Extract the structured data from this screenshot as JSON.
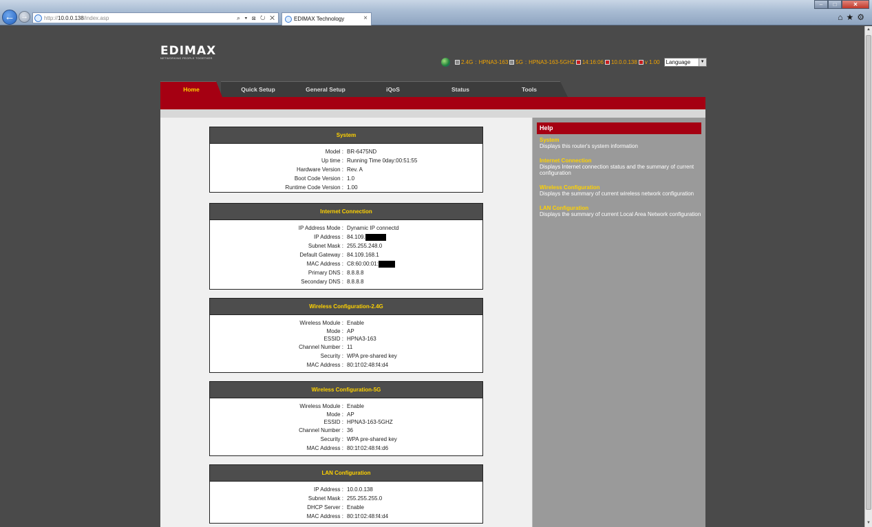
{
  "browser": {
    "url_prefix": "http://",
    "url_host": "10.0.0.138",
    "url_path": "/index.asp",
    "tab_title": "EDIMAX Technology",
    "tab_close": "×",
    "address_tools": "⌕ ▾ ⊠ ↻ ✕",
    "window_min": "–",
    "window_max": "□",
    "window_close": "✕",
    "icons": {
      "home": "home-icon",
      "star": "star-icon",
      "gear": "gear-icon"
    }
  },
  "header": {
    "logo": "EDIMAX",
    "tagline": "NETWORKING PEOPLE TOGETHER",
    "status": {
      "band1": "2.4G",
      "ssid1": "HPNA3-163",
      "band2": "5G",
      "ssid2": "HPNA3-163-5GHZ",
      "time": "14:16:06",
      "ip": "10.0.0.138",
      "version": "v 1.00"
    },
    "language": "Language"
  },
  "nav": {
    "tabs": [
      "Home",
      "Quick Setup",
      "General Setup",
      "iQoS",
      "Status",
      "Tools"
    ],
    "active": "Home"
  },
  "panels": {
    "system": {
      "title": "System",
      "rows": [
        {
          "k": "Model :",
          "v": "BR-6475ND"
        },
        {
          "k": "Up time :",
          "v": "Running Time 0day:00:51:55"
        },
        {
          "k": "Hardware Version :",
          "v": "Rev. A"
        },
        {
          "k": "Boot Code Version :",
          "v": "1.0"
        },
        {
          "k": "Runtime Code Version :",
          "v": "1.00"
        }
      ]
    },
    "internet": {
      "title": "Internet Connection",
      "rows": [
        {
          "k": "IP Address Mode :",
          "v": "Dynamic IP connectd"
        },
        {
          "k": "IP Address :",
          "v": "84.109."
        },
        {
          "k": "Subnet Mask :",
          "v": "255.255.248.0"
        },
        {
          "k": "Default Gateway :",
          "v": "84.109.168.1"
        },
        {
          "k": "MAC Address :",
          "v": "C8:60:00:01:"
        },
        {
          "k": "Primary DNS :",
          "v": "8.8.8.8"
        },
        {
          "k": "Secondary DNS :",
          "v": "8.8.8.8"
        }
      ]
    },
    "wireless24": {
      "title": "Wireless Configuration-2.4G",
      "rows": [
        {
          "k": "Wireless Module :",
          "v": "Enable"
        },
        {
          "k": "Mode :",
          "v": "AP"
        },
        {
          "k": "ESSID :",
          "v": "HPNA3-163"
        },
        {
          "k": "Channel Number :",
          "v": "11"
        },
        {
          "k": "Security :",
          "v": "WPA pre-shared key"
        },
        {
          "k": "MAC Address :",
          "v": "80:1f:02:48:f4:d4"
        }
      ]
    },
    "wireless5": {
      "title": "Wireless Configuration-5G",
      "rows": [
        {
          "k": "Wireless Module :",
          "v": "Enable"
        },
        {
          "k": "Mode :",
          "v": "AP"
        },
        {
          "k": "ESSID :",
          "v": "HPNA3-163-5GHZ"
        },
        {
          "k": "Channel Number :",
          "v": "36"
        },
        {
          "k": "Security :",
          "v": "WPA pre-shared key"
        },
        {
          "k": "MAC Address :",
          "v": "80:1f:02:48:f4:d6"
        }
      ]
    },
    "lan": {
      "title": "LAN Configuration",
      "rows": [
        {
          "k": "IP Address :",
          "v": "10.0.0.138"
        },
        {
          "k": "Subnet Mask :",
          "v": "255.255.255.0"
        },
        {
          "k": "DHCP Server :",
          "v": "Enable"
        },
        {
          "k": "MAC Address :",
          "v": "80:1f:02:48:f4:d4"
        }
      ]
    }
  },
  "help": {
    "title": "Help",
    "items": [
      {
        "title": "System",
        "desc": "Displays this router's system information"
      },
      {
        "title": "Internet Connection",
        "desc": "Displays Internet connection status and the summary of current configuration"
      },
      {
        "title": "Wireless Configuration",
        "desc": "Displays the summary of current wireless network configuration"
      },
      {
        "title": "LAN Configuration",
        "desc": "Displays the summary of current Local Area Network configuration"
      }
    ]
  }
}
